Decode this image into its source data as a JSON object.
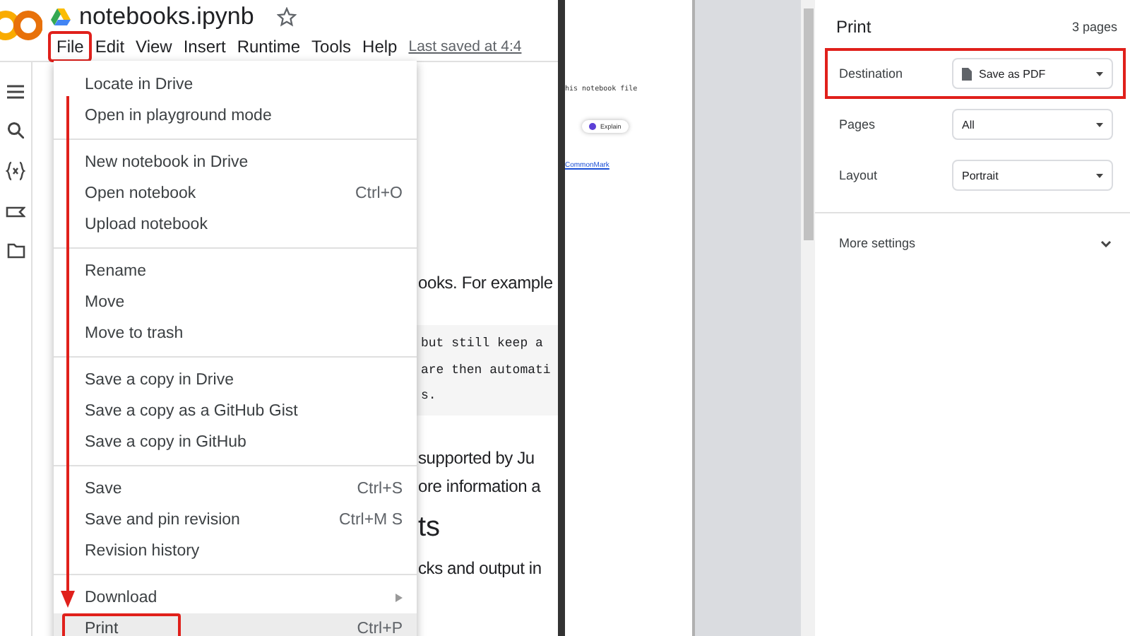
{
  "app": {
    "title": "notebooks.ipynb",
    "last_saved": "Last saved at 4:4",
    "menus": [
      {
        "label": "File",
        "highlighted": true
      },
      {
        "label": "Edit",
        "highlighted": false
      },
      {
        "label": "View",
        "highlighted": false
      },
      {
        "label": "Insert",
        "highlighted": false
      },
      {
        "label": "Runtime",
        "highlighted": false
      },
      {
        "label": "Tools",
        "highlighted": false
      },
      {
        "label": "Help",
        "highlighted": false
      }
    ]
  },
  "file_menu": {
    "groups": [
      {
        "items": [
          {
            "label": "Locate in Drive",
            "selected": false,
            "highlighted": false
          },
          {
            "label": "Open in playground mode",
            "selected": false,
            "highlighted": false
          }
        ]
      },
      {
        "items": [
          {
            "label": "New notebook in Drive",
            "selected": false,
            "highlighted": false
          },
          {
            "label": "Open notebook",
            "shortcut": "Ctrl+O",
            "selected": false,
            "highlighted": false
          },
          {
            "label": "Upload notebook",
            "selected": false,
            "highlighted": false
          }
        ]
      },
      {
        "items": [
          {
            "label": "Rename",
            "selected": false,
            "highlighted": false
          },
          {
            "label": "Move",
            "selected": false,
            "highlighted": false
          },
          {
            "label": "Move to trash",
            "selected": false,
            "highlighted": false
          }
        ]
      },
      {
        "items": [
          {
            "label": "Save a copy in Drive",
            "selected": false,
            "highlighted": false
          },
          {
            "label": "Save a copy as a GitHub Gist",
            "selected": false,
            "highlighted": false
          },
          {
            "label": "Save a copy in GitHub",
            "selected": false,
            "highlighted": false
          }
        ]
      },
      {
        "items": [
          {
            "label": "Save",
            "shortcut": "Ctrl+S",
            "selected": false,
            "highlighted": false
          },
          {
            "label": "Save and pin revision",
            "shortcut": "Ctrl+M S",
            "selected": false,
            "highlighted": false
          },
          {
            "label": "Revision history",
            "selected": false,
            "highlighted": false
          }
        ]
      },
      {
        "items": [
          {
            "label": "Download",
            "submenu": true,
            "selected": false,
            "highlighted": false
          },
          {
            "label": "Print",
            "shortcut": "Ctrl+P",
            "selected": true,
            "highlighted": true
          }
        ]
      }
    ]
  },
  "notebook": [
    {
      "kind": "text",
      "text": "ooks. For example"
    },
    {
      "kind": "code",
      "text": "but still keep a"
    },
    {
      "kind": "code",
      "text": "are then automati"
    },
    {
      "kind": "code",
      "text": "s."
    },
    {
      "kind": "text",
      "text": "supported by Ju"
    },
    {
      "kind": "text",
      "text": "ore information a"
    },
    {
      "kind": "heading",
      "text": "ts"
    },
    {
      "kind": "text",
      "text": "cks and output in"
    }
  ],
  "preview": {
    "snippet": "his notebook file",
    "chip": "Explain",
    "link": "CommonMark"
  },
  "print_panel": {
    "title": "Print",
    "page_count": "3 pages",
    "fields": [
      {
        "label": "Destination",
        "value": "Save as PDF",
        "kind": "file",
        "highlighted": true
      },
      {
        "label": "Pages",
        "value": "All",
        "kind": "plain",
        "highlighted": false
      },
      {
        "label": "Layout",
        "value": "Portrait",
        "kind": "plain",
        "highlighted": false
      }
    ],
    "more_settings": "More settings"
  }
}
